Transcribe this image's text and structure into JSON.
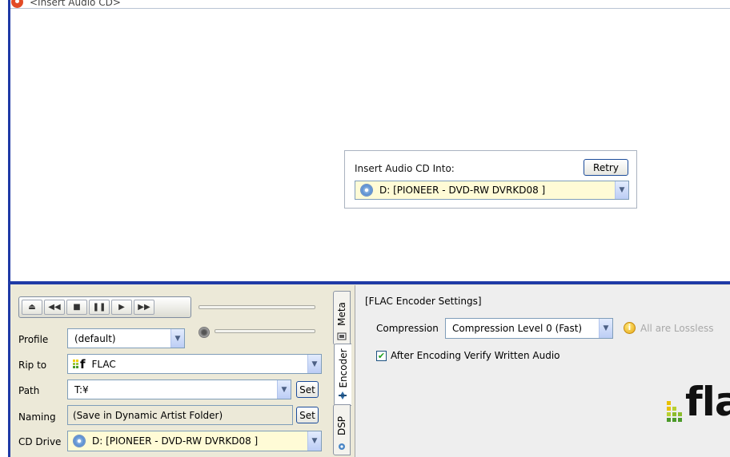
{
  "window": {
    "title": "<Insert Audio CD>"
  },
  "insert_panel": {
    "label": "Insert Audio CD Into:",
    "retry_label": "Retry",
    "drive_value": "D:  [PIONEER  - DVD-RW  DVRKD08 ]"
  },
  "transport": {
    "buttons": [
      "eject",
      "rewind",
      "stop",
      "pause",
      "play",
      "forward"
    ]
  },
  "form": {
    "profile_label": "Profile",
    "profile_value": "(default)",
    "rip_to_label": "Rip to",
    "rip_to_value": "FLAC",
    "path_label": "Path",
    "path_value": "T:¥",
    "path_set_label": "Set",
    "naming_label": "Naming",
    "naming_value": "(Save in Dynamic Artist Folder)",
    "naming_set_label": "Set",
    "cd_drive_label": "CD Drive",
    "cd_drive_value": "D:  [PIONEER  - DVD-RW  DVRKD08 ]"
  },
  "tabs": {
    "meta": "Meta",
    "encoder": "Encoder",
    "dsp": "DSP"
  },
  "encoder": {
    "section_title": "[FLAC Encoder Settings]",
    "compression_label": "Compression",
    "compression_value": "Compression Level 0  (Fast)",
    "lossless_note": "All are Lossless",
    "verify_label": "After Encoding Verify Written Audio",
    "verify_checked": true,
    "logo_text": "fla"
  },
  "colors": {
    "accent_blue": "#1f3aa6",
    "combo_bg": "#fffbd6",
    "panel_bg": "#ece9d8"
  }
}
